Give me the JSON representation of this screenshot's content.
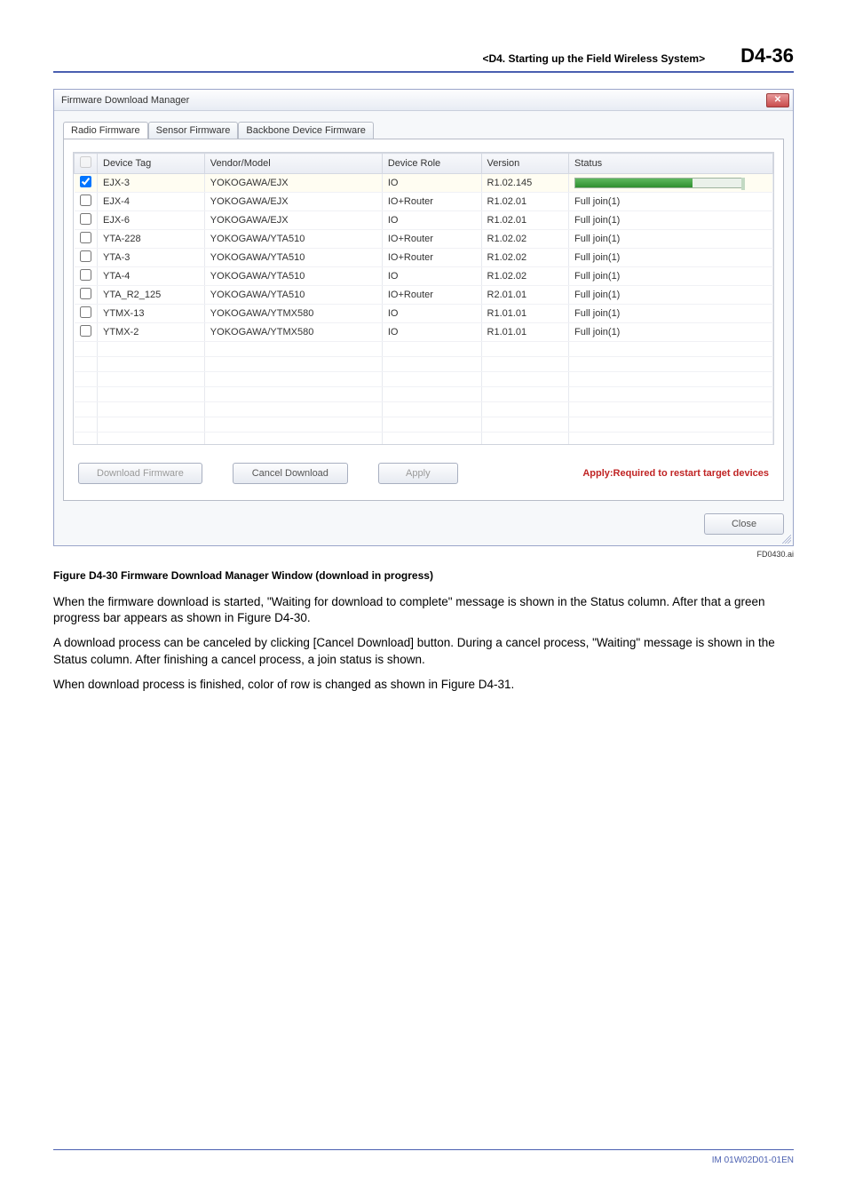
{
  "header": {
    "section": "<D4.  Starting up the Field Wireless System>",
    "page": "D4-36"
  },
  "window": {
    "title": "Firmware Download Manager",
    "tabs": {
      "radio": "Radio Firmware",
      "sensor": "Sensor Firmware",
      "backbone": "Backbone Device Firmware"
    },
    "columns": {
      "tag": "Device Tag",
      "vendor": "Vendor/Model",
      "role": "Device Role",
      "version": "Version",
      "status": "Status"
    },
    "rows": [
      {
        "tag": "EJX-3",
        "vendor": "YOKOGAWA/EJX",
        "role": "IO",
        "version": "R1.02.145",
        "status": ""
      },
      {
        "tag": "EJX-4",
        "vendor": "YOKOGAWA/EJX",
        "role": "IO+Router",
        "version": "R1.02.01",
        "status": "Full join(1)"
      },
      {
        "tag": "EJX-6",
        "vendor": "YOKOGAWA/EJX",
        "role": "IO",
        "version": "R1.02.01",
        "status": "Full join(1)"
      },
      {
        "tag": "YTA-228",
        "vendor": "YOKOGAWA/YTA510",
        "role": "IO+Router",
        "version": "R1.02.02",
        "status": "Full join(1)"
      },
      {
        "tag": "YTA-3",
        "vendor": "YOKOGAWA/YTA510",
        "role": "IO+Router",
        "version": "R1.02.02",
        "status": "Full join(1)"
      },
      {
        "tag": "YTA-4",
        "vendor": "YOKOGAWA/YTA510",
        "role": "IO",
        "version": "R1.02.02",
        "status": "Full join(1)"
      },
      {
        "tag": "YTA_R2_125",
        "vendor": "YOKOGAWA/YTA510",
        "role": "IO+Router",
        "version": "R2.01.01",
        "status": "Full join(1)"
      },
      {
        "tag": "YTMX-13",
        "vendor": "YOKOGAWA/YTMX580",
        "role": "IO",
        "version": "R1.01.01",
        "status": "Full join(1)"
      },
      {
        "tag": "YTMX-2",
        "vendor": "YOKOGAWA/YTMX580",
        "role": "IO",
        "version": "R1.01.01",
        "status": "Full join(1)"
      }
    ],
    "buttons": {
      "download": "Download Firmware",
      "cancel": "Cancel Download",
      "apply": "Apply",
      "note": "Apply:Required to restart target devices",
      "close": "Close"
    }
  },
  "figure_id": "FD0430.ai",
  "caption": "Figure D4-30  Firmware Download Manager Window (download in progress)",
  "paragraphs": {
    "p1": "When the firmware download is started, \"Waiting for download to complete\" message is shown in the Status column.  After that a green progress bar appears as shown in Figure D4-30.",
    "p2": "A download process can be canceled by clicking [Cancel Download] button.  During a cancel process, \"Waiting\" message is shown in the Status column.  After finishing a cancel process, a join status is shown.",
    "p3": "When download process is finished, color of row is changed as shown in Figure D4-31."
  },
  "footer": "IM 01W02D01-01EN"
}
